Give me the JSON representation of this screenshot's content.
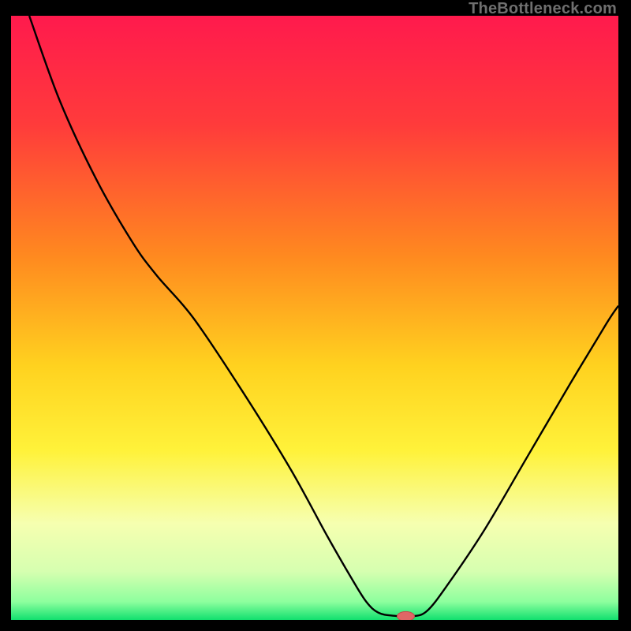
{
  "watermark": "TheBottleneck.com",
  "colors": {
    "curve": "#000000",
    "marker_fill": "#e06666",
    "marker_stroke": "#c24a4a"
  },
  "chart_data": {
    "type": "line",
    "title": "",
    "xlabel": "",
    "ylabel": "",
    "xlim": [
      0,
      100
    ],
    "ylim": [
      0,
      100
    ],
    "gradient_stops": [
      {
        "offset": 0.0,
        "color": "#ff1a4d"
      },
      {
        "offset": 0.18,
        "color": "#ff3b3b"
      },
      {
        "offset": 0.4,
        "color": "#ff8a1f"
      },
      {
        "offset": 0.58,
        "color": "#ffd21f"
      },
      {
        "offset": 0.72,
        "color": "#fff23a"
      },
      {
        "offset": 0.84,
        "color": "#f6ffb0"
      },
      {
        "offset": 0.92,
        "color": "#d6ffb0"
      },
      {
        "offset": 0.97,
        "color": "#8dff9e"
      },
      {
        "offset": 1.0,
        "color": "#11e06e"
      }
    ],
    "curve_points": [
      {
        "x": 3.0,
        "y": 100.0
      },
      {
        "x": 8.0,
        "y": 86.0
      },
      {
        "x": 14.0,
        "y": 73.0
      },
      {
        "x": 20.0,
        "y": 62.5
      },
      {
        "x": 24.0,
        "y": 57.0
      },
      {
        "x": 30.0,
        "y": 50.0
      },
      {
        "x": 38.0,
        "y": 38.0
      },
      {
        "x": 46.0,
        "y": 25.0
      },
      {
        "x": 52.0,
        "y": 14.0
      },
      {
        "x": 56.0,
        "y": 7.0
      },
      {
        "x": 58.5,
        "y": 3.0
      },
      {
        "x": 60.5,
        "y": 1.2
      },
      {
        "x": 63.0,
        "y": 0.7
      },
      {
        "x": 66.0,
        "y": 0.6
      },
      {
        "x": 68.5,
        "y": 1.5
      },
      {
        "x": 72.0,
        "y": 6.0
      },
      {
        "x": 78.0,
        "y": 15.0
      },
      {
        "x": 85.0,
        "y": 27.0
      },
      {
        "x": 92.0,
        "y": 39.0
      },
      {
        "x": 98.0,
        "y": 49.0
      },
      {
        "x": 100.0,
        "y": 52.0
      }
    ],
    "marker": {
      "x": 65.0,
      "y": 0.6,
      "rx": 11,
      "ry": 6
    }
  }
}
